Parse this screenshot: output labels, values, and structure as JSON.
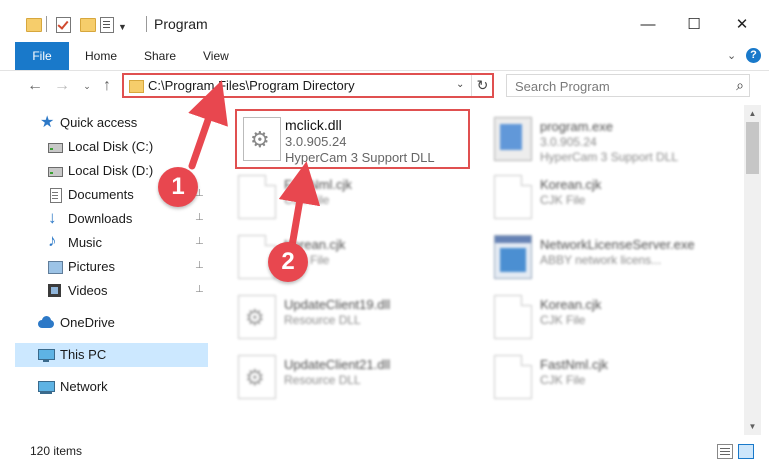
{
  "window": {
    "title": "Program",
    "minimize": "—",
    "maximize": "☐",
    "close": "✕"
  },
  "ribbon": {
    "tabs": [
      "File",
      "Home",
      "Share",
      "View"
    ],
    "help": "?",
    "expand": "⌄"
  },
  "nav_buttons": {
    "back": "←",
    "forward": "→",
    "recent": "⌄",
    "up": "↑"
  },
  "address": {
    "path": "C:\\Program Files\\Program Directory",
    "dropdown": "⌄",
    "refresh": "↻"
  },
  "search": {
    "placeholder": "Search Program",
    "icon": "search-icon"
  },
  "navpane": {
    "items": [
      {
        "label": "Quick access",
        "icon": "star-icon"
      },
      {
        "label": "Local Disk (C:)",
        "icon": "disk-icon",
        "pinned": true
      },
      {
        "label": "Local Disk (D:)",
        "icon": "disk-icon",
        "pinned": true
      },
      {
        "label": "Documents",
        "icon": "documents-icon",
        "pinned": true
      },
      {
        "label": "Downloads",
        "icon": "downloads-icon",
        "pinned": true
      },
      {
        "label": "Music",
        "icon": "music-icon",
        "pinned": true
      },
      {
        "label": "Pictures",
        "icon": "pictures-icon",
        "pinned": true
      },
      {
        "label": "Videos",
        "icon": "videos-icon",
        "pinned": true
      },
      {
        "label": "OneDrive",
        "icon": "onedrive-icon"
      },
      {
        "label": "This PC",
        "icon": "pc-icon",
        "selected": true
      },
      {
        "label": "Network",
        "icon": "network-icon"
      }
    ],
    "pin_glyph": "📌"
  },
  "files": {
    "highlighted": {
      "name": "mclick.dll",
      "line1": "3.0.905.24",
      "line2": "HyperCam 3 Support DLL",
      "icon": "dll-icon"
    },
    "others": [
      {
        "name": "program.exe",
        "line1": "3.0.905.24",
        "line2": "HyperCam 3 Support DLL",
        "icon": "exe-icon"
      },
      {
        "name": "FastNml.cjk",
        "line1": "CJK File",
        "line2": "",
        "icon": "document-icon"
      },
      {
        "name": "Korean.cjk",
        "line1": "CJK File",
        "line2": "",
        "icon": "document-icon"
      },
      {
        "name": "Korean.cjk",
        "line1": "CJK File",
        "line2": "",
        "icon": "document-icon"
      },
      {
        "name": "NetworkLicenseServer.exe",
        "line1": "ABBY network licens...",
        "line2": "",
        "icon": "window-icon"
      },
      {
        "name": "UpdateClient19.dll",
        "line1": "Resource DLL",
        "line2": "",
        "icon": "dll-icon"
      },
      {
        "name": "Korean.cjk",
        "line1": "CJK File",
        "line2": "",
        "icon": "document-icon"
      },
      {
        "name": "UpdateClient21.dll",
        "line1": "Resource DLL",
        "line2": "",
        "icon": "dll-icon"
      },
      {
        "name": "FastNml.cjk",
        "line1": "CJK File",
        "line2": "",
        "icon": "document-icon"
      }
    ]
  },
  "status": {
    "items": "120 items"
  },
  "annotations": {
    "badge1": "1",
    "badge2": "2"
  },
  "colors": {
    "accent": "#1979ca",
    "highlight": "#e05050",
    "badge": "#e8474f",
    "selected": "#cce8ff"
  }
}
